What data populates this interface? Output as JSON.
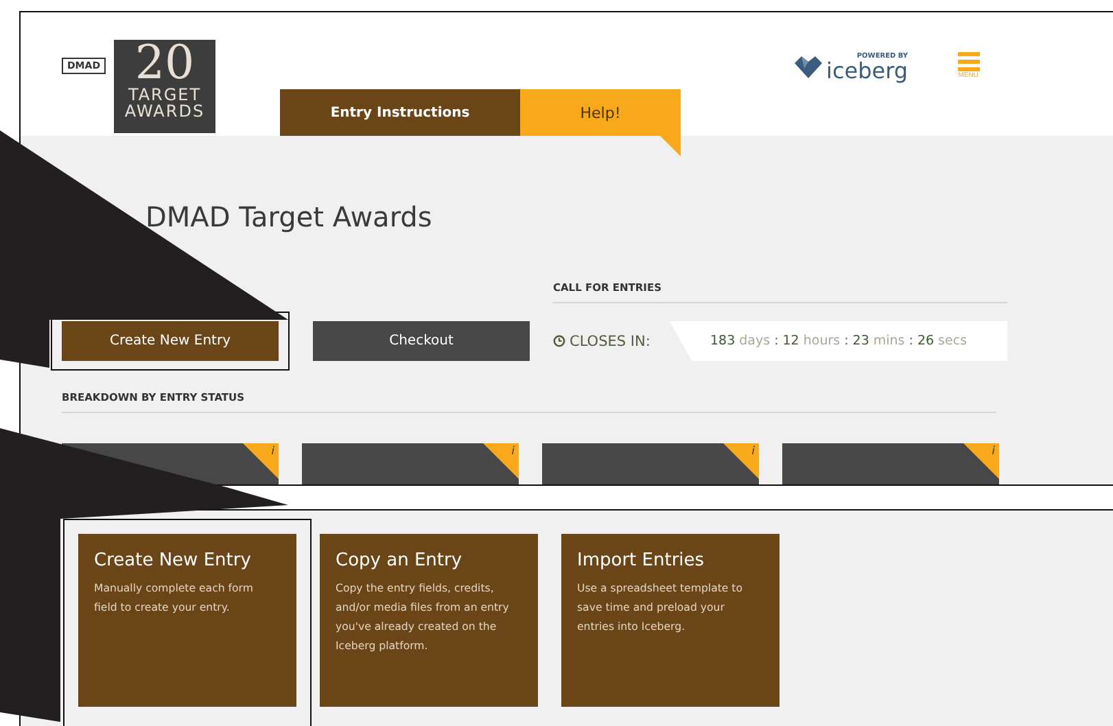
{
  "header": {
    "logo_badge": "DMAD",
    "logo_number": "20",
    "logo_lines": [
      "TARGET",
      "AWARDS"
    ],
    "tabs": [
      {
        "label": "Entry Instructions",
        "kind": "primary"
      },
      {
        "label": "Help!",
        "kind": "accent"
      }
    ],
    "brand_tagline": "POWERED BY",
    "brand_name": "iceberg",
    "menu_label": "MENU"
  },
  "title": "DMAD Target Awards",
  "call_for_entries": {
    "heading": "CALL FOR ENTRIES",
    "label": "CLOSES IN:",
    "separator": ":",
    "countdown": [
      {
        "value": "183",
        "unit": "days"
      },
      {
        "value": "12",
        "unit": "hours"
      },
      {
        "value": "23",
        "unit": "mins"
      },
      {
        "value": "26",
        "unit": "secs"
      }
    ]
  },
  "actions": [
    {
      "label": "Create New Entry",
      "kind": "primary",
      "highlighted": true
    },
    {
      "label": "Checkout",
      "kind": "dark",
      "highlighted": false
    }
  ],
  "breakdown": {
    "heading": "BREAKDOWN BY ENTRY STATUS",
    "cards": [
      {
        "info": "i"
      },
      {
        "info": "i"
      },
      {
        "info": "i"
      },
      {
        "info": "i"
      }
    ]
  },
  "options": [
    {
      "title": "Create New Entry",
      "description": "Manually complete each form field to create your entry.",
      "highlighted": true
    },
    {
      "title": "Copy an Entry",
      "description": "Copy the entry fields, credits, and/or media files from an entry you've already created on the Iceberg platform.",
      "highlighted": false
    },
    {
      "title": "Import Entries",
      "description": "Use a spreadsheet template to save time and preload your entries into Iceberg.",
      "highlighted": false
    }
  ]
}
